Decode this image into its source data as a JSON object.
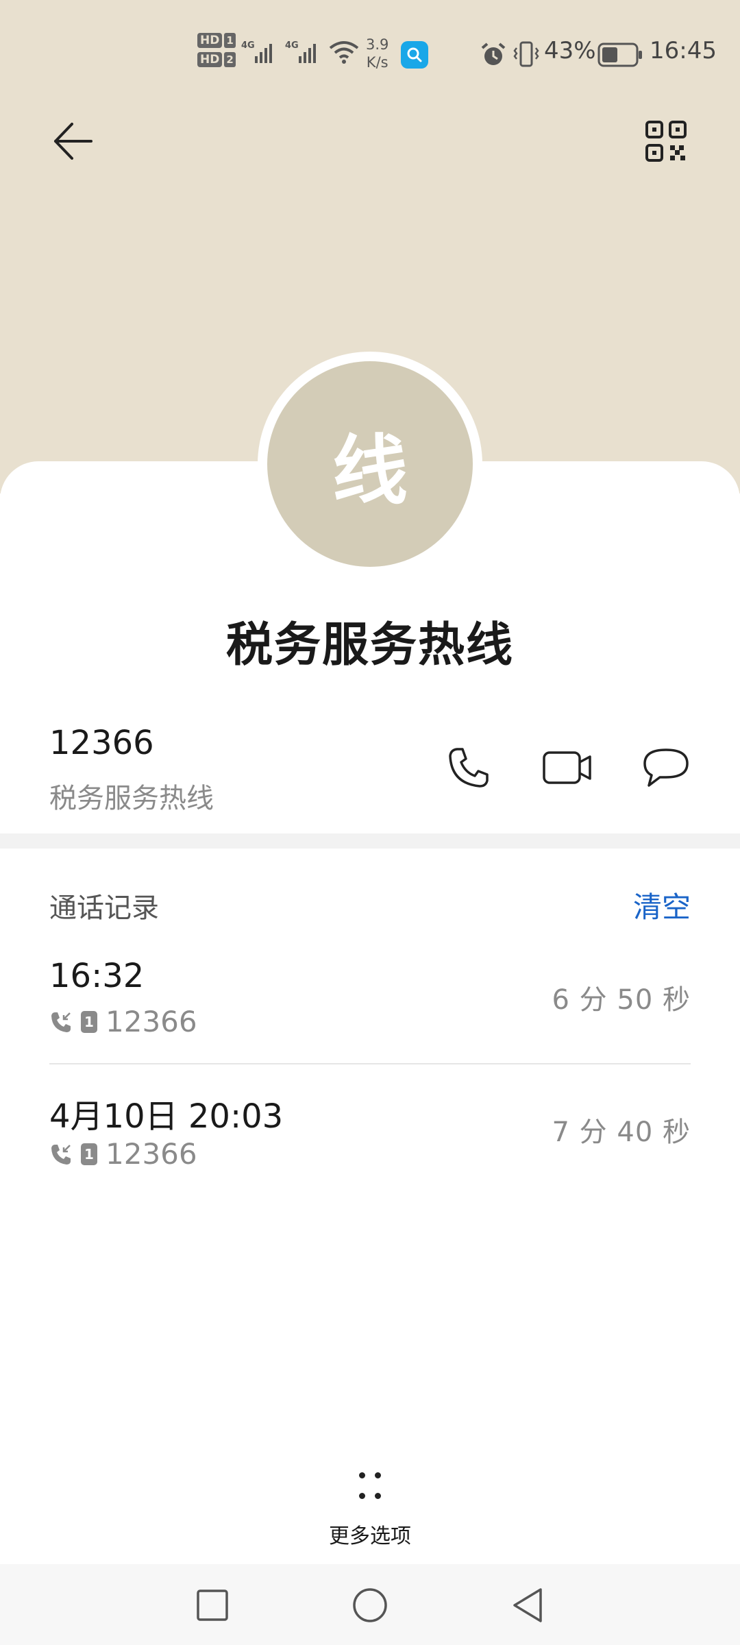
{
  "status_bar": {
    "sim1": {
      "hd": "HD",
      "slot": "1",
      "network": "4G"
    },
    "sim2": {
      "hd": "HD",
      "slot": "2",
      "network": "4G"
    },
    "speed_value": "3.9",
    "speed_unit": "K/s",
    "battery_pct": "43%",
    "time": "16:45"
  },
  "header": {
    "back_icon": "arrow-left-icon",
    "qr_icon": "qr-code-icon",
    "background_color": "#e8e0cf"
  },
  "contact": {
    "avatar_char": "线",
    "avatar_color": "#d3ccb7",
    "name": "税务服务热线",
    "number": "12366",
    "number_label": "税务服务热线",
    "actions": [
      "phone-icon",
      "video-call-icon",
      "message-icon"
    ]
  },
  "call_log": {
    "title": "通话记录",
    "clear_label": "清空",
    "accent_color": "#1a64c8",
    "entries": [
      {
        "time": "16:32",
        "sim": "1",
        "number": "12366",
        "duration": "6 分 50 秒"
      },
      {
        "time": "4月10日 20:03",
        "sim": "1",
        "number": "12366",
        "duration": "7 分 40 秒"
      }
    ]
  },
  "more_options": {
    "label": "更多选项"
  },
  "nav_bar": {
    "buttons": [
      "recent-apps-icon",
      "home-icon",
      "back-icon"
    ]
  }
}
